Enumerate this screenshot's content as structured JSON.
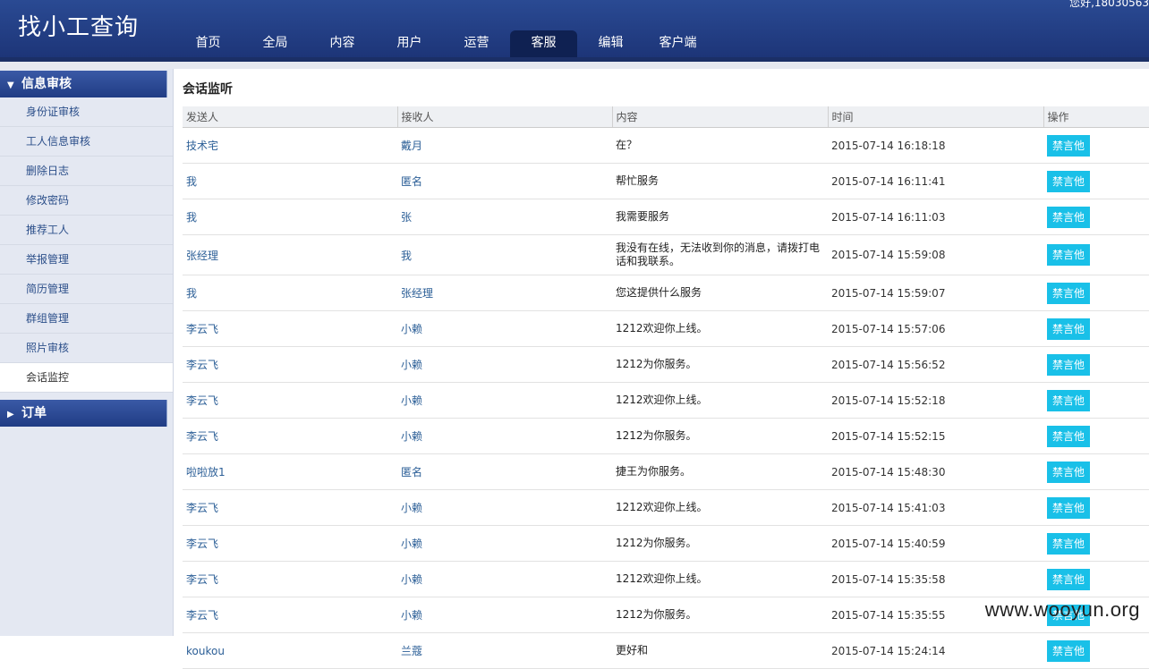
{
  "header": {
    "logo": "找小工查询",
    "greeting": "您好,18030563",
    "nav": [
      "首页",
      "全局",
      "内容",
      "用户",
      "运营",
      "客服",
      "编辑",
      "客户端"
    ],
    "active_nav_index": 5
  },
  "sidebar": {
    "group1": "信息审核",
    "items": [
      "身份证审核",
      "工人信息审核",
      "删除日志",
      "修改密码",
      "推荐工人",
      "举报管理",
      "简历管理",
      "群组管理",
      "照片审核",
      "会话监控"
    ],
    "active_item_index": 9,
    "group2": "订单"
  },
  "main": {
    "title": "会话监听",
    "columns": [
      "发送人",
      "接收人",
      "内容",
      "时间",
      "操作"
    ],
    "action_label": "禁言他",
    "rows": [
      {
        "sender": "技术宅",
        "receiver": "戴月",
        "content": "在？",
        "time": "2015-07-14 16:18:18"
      },
      {
        "sender": "我",
        "receiver": "匿名",
        "content": "帮忙服务",
        "time": "2015-07-14 16:11:41"
      },
      {
        "sender": "我",
        "receiver": "张",
        "content": "我需要服务",
        "time": "2015-07-14 16:11:03"
      },
      {
        "sender": "张经理",
        "receiver": "我",
        "content": "我没有在线，无法收到你的消息，请拨打电话和我联系。",
        "time": "2015-07-14 15:59:08"
      },
      {
        "sender": "我",
        "receiver": "张经理",
        "content": "您这提供什么服务",
        "time": "2015-07-14 15:59:07"
      },
      {
        "sender": "李云飞",
        "receiver": "小赖",
        "content": "1212欢迎你上线。",
        "time": "2015-07-14 15:57:06"
      },
      {
        "sender": "李云飞",
        "receiver": "小赖",
        "content": "1212为你服务。",
        "time": "2015-07-14 15:56:52"
      },
      {
        "sender": "李云飞",
        "receiver": "小赖",
        "content": "1212欢迎你上线。",
        "time": "2015-07-14 15:52:18"
      },
      {
        "sender": "李云飞",
        "receiver": "小赖",
        "content": "1212为你服务。",
        "time": "2015-07-14 15:52:15"
      },
      {
        "sender": "啦啦放1",
        "receiver": "匿名",
        "content": "捷王为你服务。",
        "time": "2015-07-14 15:48:30"
      },
      {
        "sender": "李云飞",
        "receiver": "小赖",
        "content": "1212欢迎你上线。",
        "time": "2015-07-14 15:41:03"
      },
      {
        "sender": "李云飞",
        "receiver": "小赖",
        "content": "1212为你服务。",
        "time": "2015-07-14 15:40:59"
      },
      {
        "sender": "李云飞",
        "receiver": "小赖",
        "content": "1212欢迎你上线。",
        "time": "2015-07-14 15:35:58"
      },
      {
        "sender": "李云飞",
        "receiver": "小赖",
        "content": "1212为你服务。",
        "time": "2015-07-14 15:35:55"
      },
      {
        "sender": "koukou",
        "receiver": "兰蔻",
        "content": "更好和",
        "time": "2015-07-14 15:24:14"
      }
    ]
  },
  "watermark": "www.wooyun.org"
}
